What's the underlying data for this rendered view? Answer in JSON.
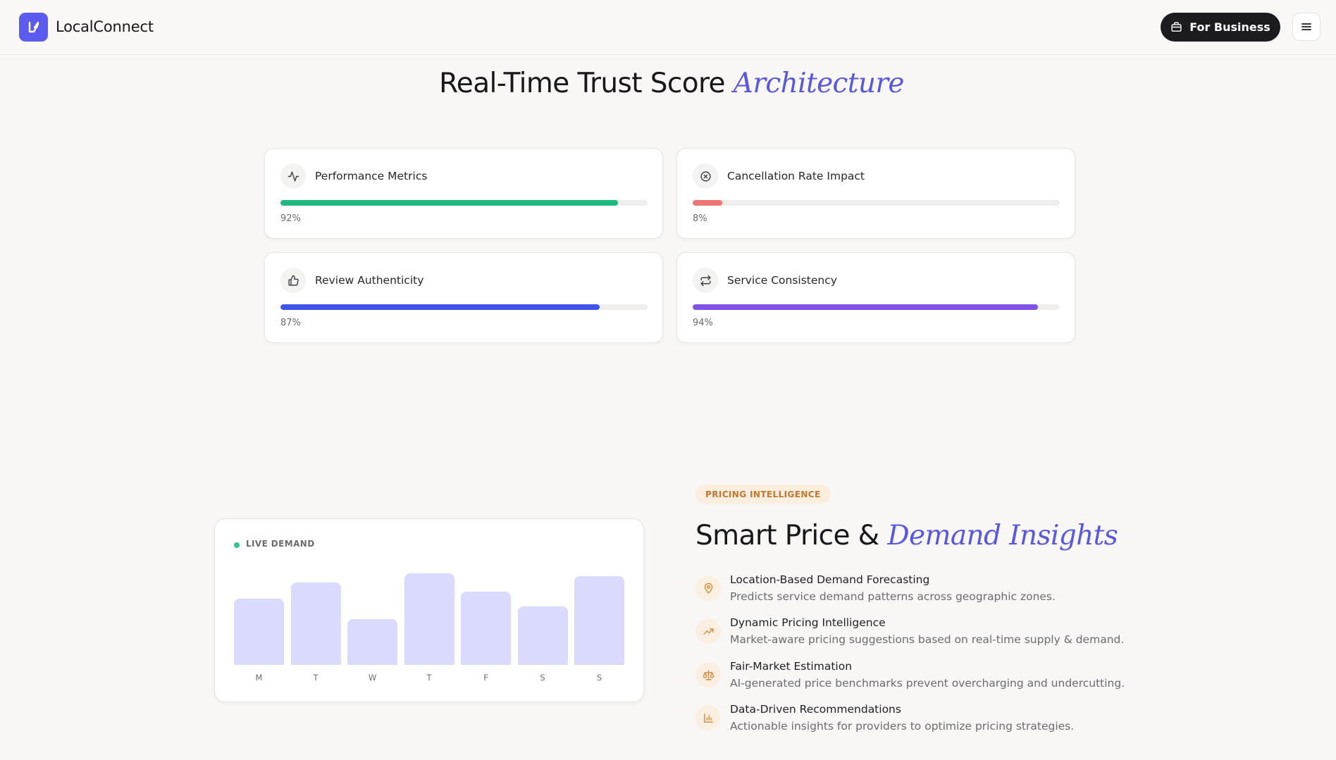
{
  "header": {
    "brand": "LocalConnect",
    "business_button": "For Business"
  },
  "trust": {
    "title_main": "Real-Time Trust Score",
    "title_accent": "Architecture",
    "metrics": [
      {
        "label": "Performance Metrics",
        "value": "92%",
        "percent": 92,
        "color": "#1db97f",
        "icon": "activity-icon"
      },
      {
        "label": "Cancellation Rate Impact",
        "value": "8%",
        "percent": 8,
        "color": "#f07474",
        "icon": "x-circle-icon"
      },
      {
        "label": "Review Authenticity",
        "value": "87%",
        "percent": 87,
        "color": "#3f55e8",
        "icon": "thumbs-up-icon"
      },
      {
        "label": "Service Consistency",
        "value": "94%",
        "percent": 94,
        "color": "#8052e6",
        "icon": "repeat-icon"
      }
    ]
  },
  "demand": {
    "live_label": "LIVE DEMAND",
    "days": [
      "M",
      "T",
      "W",
      "T",
      "F",
      "S",
      "S"
    ],
    "levels": [
      0.72,
      0.9,
      0.5,
      1.0,
      0.8,
      0.64,
      0.97
    ],
    "bar_color": "#d9dafd",
    "status_color": "#34c38f"
  },
  "pricing": {
    "pill": "PRICING INTELLIGENCE",
    "title_main": "Smart Price &",
    "title_accent": "Demand Insights",
    "features": [
      {
        "title": "Location-Based Demand Forecasting",
        "desc": "Predicts service demand patterns across geographic zones.",
        "icon": "map-pin-icon"
      },
      {
        "title": "Dynamic Pricing Intelligence",
        "desc": "Market-aware pricing suggestions based on real-time supply & demand.",
        "icon": "trending-up-icon"
      },
      {
        "title": "Fair-Market Estimation",
        "desc": "AI-generated price benchmarks prevent overcharging and undercutting.",
        "icon": "scale-icon"
      },
      {
        "title": "Data-Driven Recommendations",
        "desc": "Actionable insights for providers to optimize pricing strategies.",
        "icon": "bar-chart-icon"
      }
    ],
    "accent_color": "#d98b3a"
  }
}
